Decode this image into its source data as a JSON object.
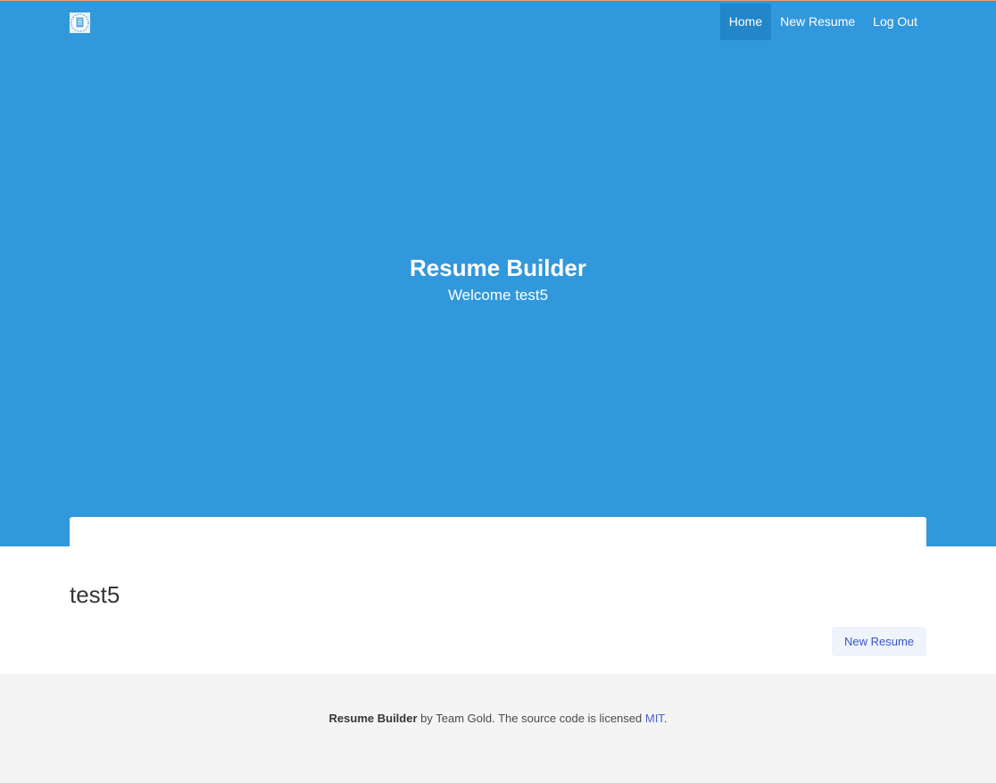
{
  "navbar": {
    "logo_icon": "resume-document-icon",
    "items": [
      {
        "label": "Home",
        "active": true
      },
      {
        "label": "New Resume",
        "active": false
      },
      {
        "label": "Log Out",
        "active": false
      }
    ]
  },
  "hero": {
    "title": "Resume Builder",
    "subtitle": "Welcome test5"
  },
  "main": {
    "username": "test5",
    "new_resume_button": "New Resume"
  },
  "footer": {
    "brand": "Resume Builder",
    "text": " by Team Gold. The source code is licensed ",
    "link": "MIT",
    "period": "."
  },
  "colors": {
    "hero_bg": "#3298dc",
    "nav_active_bg": "#2286c9",
    "footer_bg": "#f4f4f4",
    "link": "#4a5fd1"
  }
}
